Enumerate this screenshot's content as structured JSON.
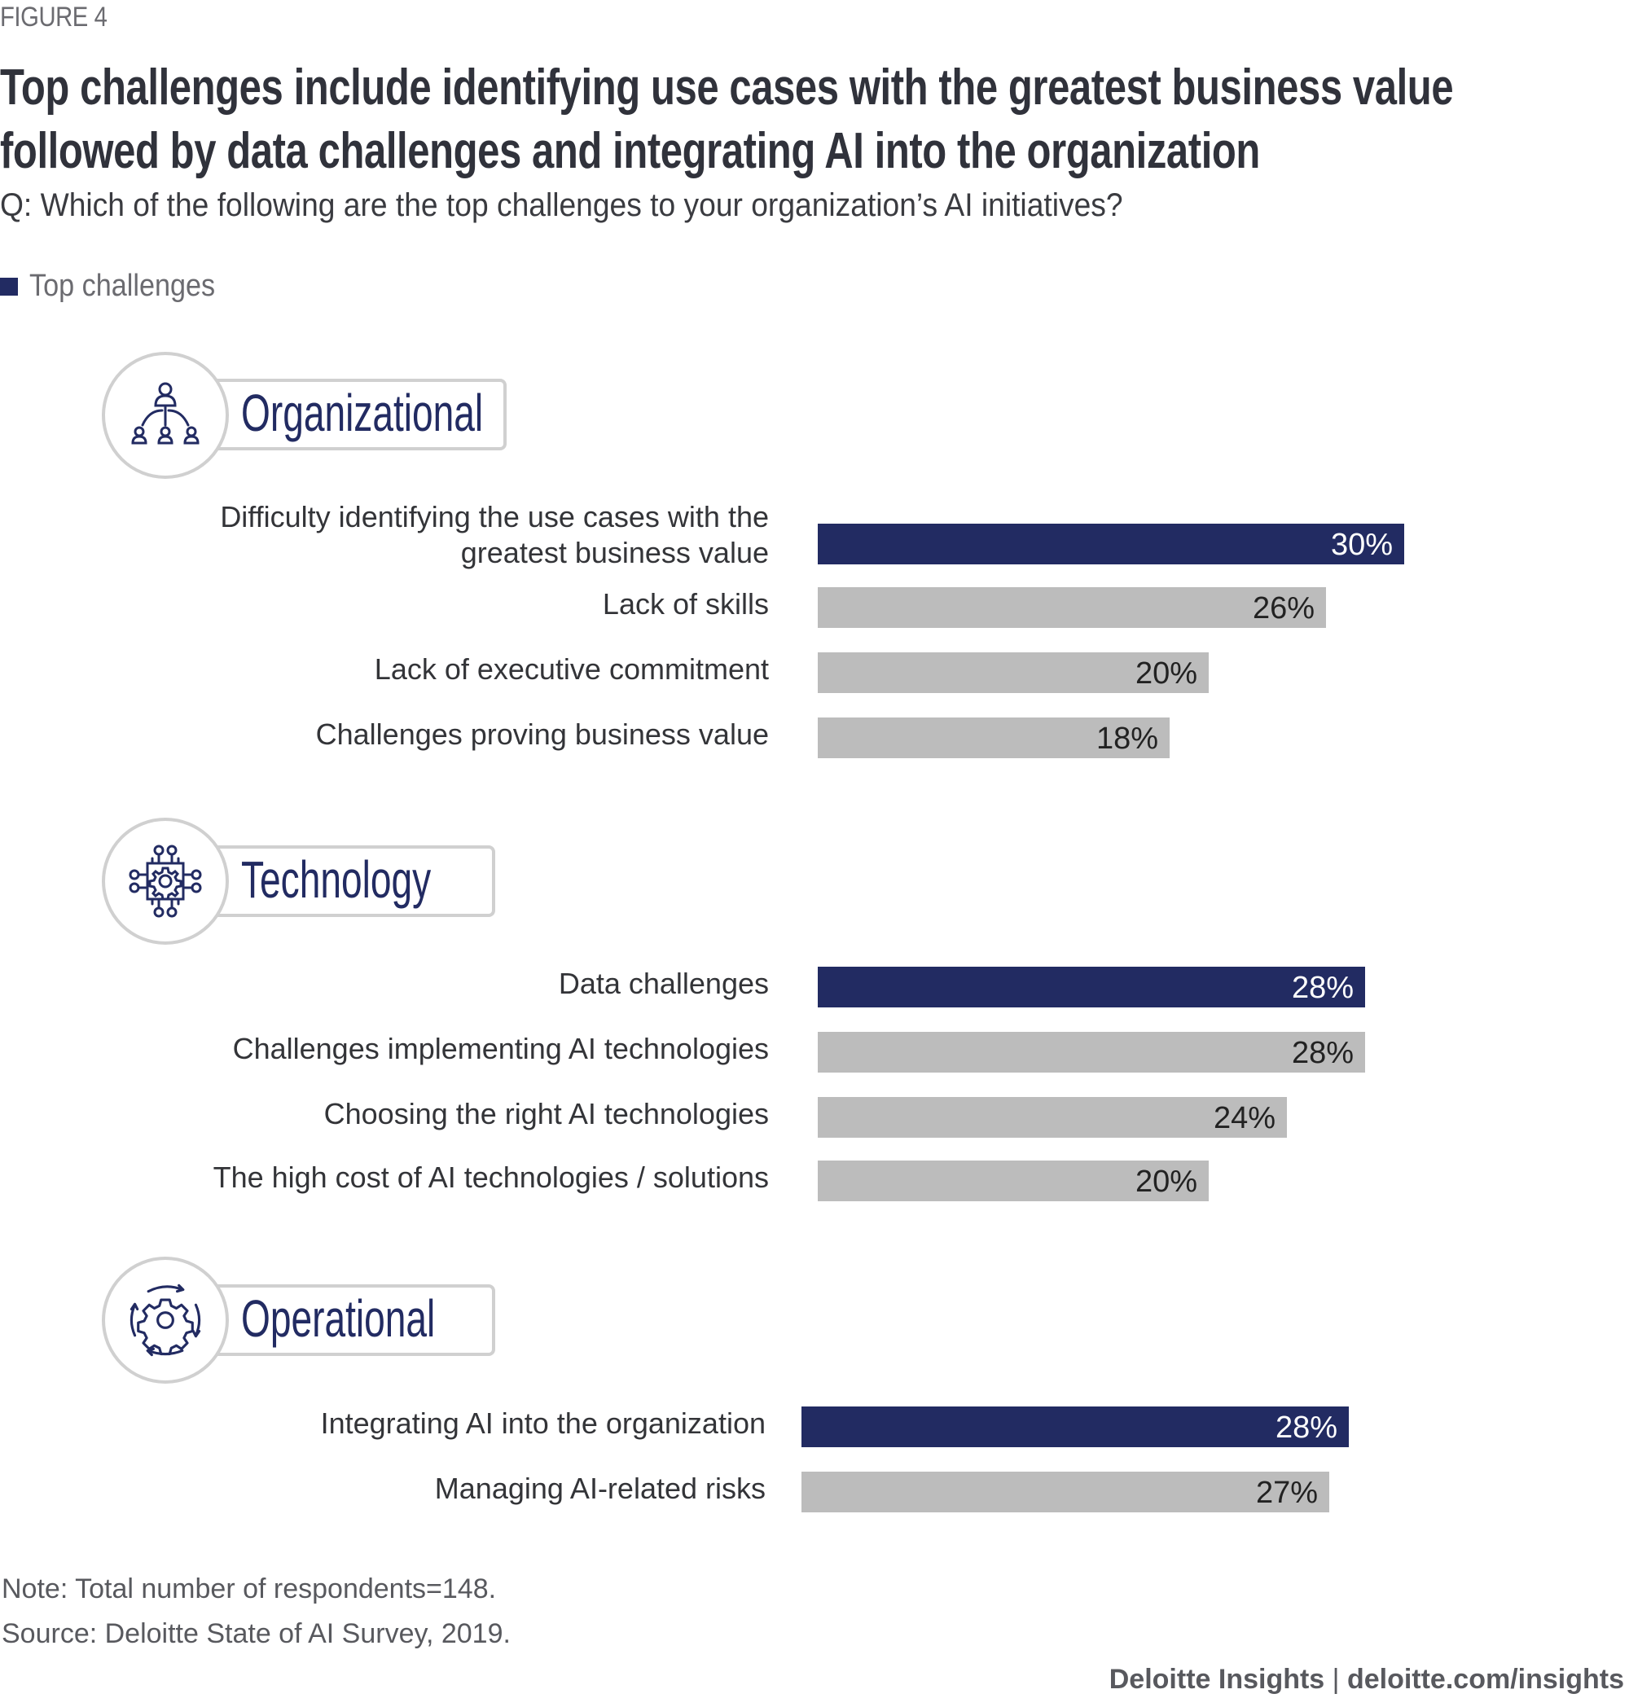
{
  "figure_label": "FIGURE 4",
  "title_lines": [
    "Top challenges include identifying use cases with the greatest business value",
    "followed by data challenges and integrating AI into the organization"
  ],
  "question": "Q: Which of the following are the top challenges to your organization’s AI initiatives?",
  "legend": {
    "label": "Top challenges",
    "color": "#222B62"
  },
  "colors": {
    "highlight": "#222B62",
    "normal": "#BCBCBC",
    "icon": "#222B62"
  },
  "sections": [
    {
      "title": "Organizational",
      "icon": "org-chart-icon"
    },
    {
      "title": "Technology",
      "icon": "chip-gear-icon"
    },
    {
      "title": "Operational",
      "icon": "gear-cycle-icon"
    }
  ],
  "chart_data": {
    "type": "bar",
    "orientation": "horizontal",
    "title": "Top challenges include identifying use cases with the greatest business value followed by data challenges and integrating AI into the organization",
    "subtitle": "Q: Which of the following are the top challenges to your organization’s AI initiatives?",
    "xlabel": "",
    "ylabel": "",
    "unit": "%",
    "xlim": [
      0,
      30
    ],
    "grid": false,
    "legend": {
      "entries": [
        "Top challenges"
      ],
      "placement": "top-left"
    },
    "groups": [
      {
        "name": "Organizational",
        "categories": [
          "Difficulty identifying the use cases with the greatest business value",
          "Lack of skills",
          "Lack of executive commitment",
          "Challenges proving business value"
        ],
        "label_lines": [
          [
            "Difficulty identifying the use cases with the",
            "greatest business value"
          ],
          [
            "Lack of skills"
          ],
          [
            "Lack of executive commitment"
          ],
          [
            "Challenges proving business value"
          ]
        ],
        "values": [
          30,
          26,
          20,
          18
        ],
        "value_labels": [
          "30%",
          "26%",
          "20%",
          "18%"
        ],
        "top_challenge": [
          true,
          false,
          false,
          false
        ]
      },
      {
        "name": "Technology",
        "categories": [
          "Data challenges",
          "Challenges implementing AI technologies",
          "Choosing the right AI technologies",
          "The high cost of AI technologies / solutions"
        ],
        "label_lines": [
          [
            "Data challenges"
          ],
          [
            "Challenges implementing AI technologies"
          ],
          [
            "Choosing the right AI technologies"
          ],
          [
            "The high cost of AI technologies / solutions"
          ]
        ],
        "values": [
          28,
          28,
          24,
          20
        ],
        "value_labels": [
          "28%",
          "28%",
          "24%",
          "20%"
        ],
        "top_challenge": [
          true,
          false,
          false,
          false
        ]
      },
      {
        "name": "Operational",
        "categories": [
          "Integrating AI into the organization",
          "Managing AI-related risks"
        ],
        "label_lines": [
          [
            "Integrating AI into the organization"
          ],
          [
            "Managing AI-related risks"
          ]
        ],
        "values": [
          28,
          27
        ],
        "value_labels": [
          "28%",
          "27%"
        ],
        "top_challenge": [
          true,
          false
        ]
      }
    ]
  },
  "footer": {
    "note": "Note: Total number of respondents=148.",
    "source": "Source: Deloitte State of AI Survey, 2019.",
    "brand": "Deloitte Insights",
    "separator": " | ",
    "url": "deloitte.com/insights"
  }
}
